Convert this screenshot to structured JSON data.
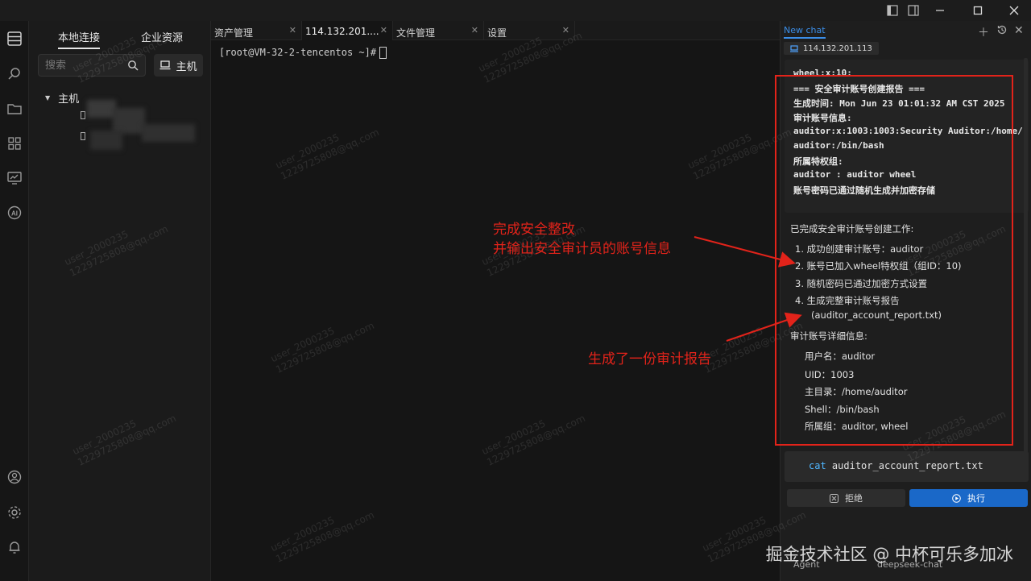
{
  "window": {
    "controls": [
      "sidebar-left-icon",
      "split-view-icon",
      "minimize-icon",
      "maximize-icon",
      "close-icon"
    ]
  },
  "activity_bar": {
    "icons": [
      "hosts-list-icon",
      "search-icon",
      "folder-icon",
      "apps-icon",
      "monitor-icon",
      "ai-icon",
      "user-icon",
      "gear-icon",
      "bell-icon"
    ]
  },
  "sidebar": {
    "tabs": [
      "本地连接",
      "企业资源"
    ],
    "search_placeholder": "搜索",
    "host_button": "主机",
    "tree_root": "主机"
  },
  "tabs": [
    {
      "label": "资产管理",
      "active": false
    },
    {
      "label": "114.132.201....",
      "active": true
    },
    {
      "label": "文件管理",
      "active": false
    },
    {
      "label": "设置",
      "active": false
    }
  ],
  "terminal": {
    "prompt": "[root@VM-32-2-tencentos ~]#"
  },
  "chat": {
    "tab_label": "New chat",
    "server": "114.132.201.113",
    "code_lines": [
      "wheel:x:10:",
      "=== 安全审计账号创建报告 ===",
      "生成时间: Mon Jun 23 01:01:32 AM CST 2025",
      "审计账号信息:",
      "auditor:x:1003:1003:Security Auditor:/home/",
      "auditor:/bin/bash",
      "所属特权组:",
      "auditor : auditor wheel",
      "账号密码已通过随机生成并加密存储"
    ],
    "summary_title": "已完成安全审计账号创建工作:",
    "steps": [
      "1. 成功创建审计账号：auditor",
      "2. 账号已加入wheel特权组（组ID：10)",
      "3. 随机密码已通过加密方式设置",
      "4. 生成完整审计账号报告",
      "(auditor_account_report.txt)"
    ],
    "details_title": "审计账号详细信息:",
    "details": [
      "用户名：auditor",
      "UID：1003",
      "主目录：/home/auditor",
      "Shell：/bin/bash",
      "所属组：auditor, wheel"
    ],
    "command_keyword": "cat",
    "command_arg": "auditor_account_report.txt",
    "reject_label": "拒绝",
    "execute_label": "执行",
    "footer_left": "Agent",
    "footer_right": "deepseek-chat"
  },
  "annotations": {
    "line1": "完成安全整改",
    "line2": "并输出安全审计员的账号信息",
    "line3": "生成了一份审计报告",
    "color": "#e2231a"
  },
  "watermark": {
    "user": "user_2000235",
    "email": "1229725808@qq.com",
    "site": "掘金技术社区 @ 中杯可乐多加冰"
  }
}
